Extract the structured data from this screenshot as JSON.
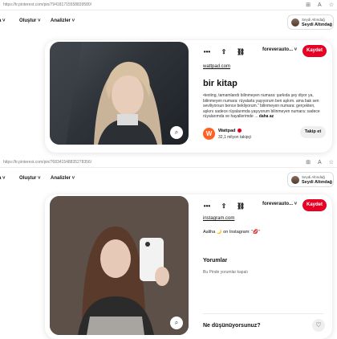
{
  "top_capture": {
    "browser": {
      "url": "https://tr.pinterest.com/pin/794181715558839580/"
    },
    "nav": {
      "left_partial": "a ˅",
      "create": "Oluştur ˅",
      "analytics": "Analizler ˅"
    },
    "account": {
      "subtitle": "Seydi Altındağ",
      "name": "Seydi Altındağ"
    },
    "pin": {
      "actions": [
        "•••",
        "⇧",
        "⛓"
      ],
      "board": "foreverauto... ˅",
      "save_label": "Kaydet",
      "source_link": "wattpad.com",
      "title": "bir kitap",
      "description": "•texting, tamamlandı bilinmeyen numara: şarkıda şey diyor ya, bilinmeyen numara: rüyalarla yaşıyorum ben aşkım. ama bak sen seviliyorsun bence bekliyorum.” bilinmeyen numara: gerçekten, aşkını sadece rüyalarımda yaşıyorum bilinmeyen numara: sadece rüyalarımda ve hayallerimde ...",
      "more": "daha az",
      "creator": {
        "logo_letter": "W",
        "name": "Wattpad",
        "followers": "32,1 milyon takipçi",
        "follow_label": "Takip et"
      }
    }
  },
  "bottom_capture": {
    "browser": {
      "url": "https://tr.pinterest.com/pin/768341548835278356/"
    },
    "nav": {
      "left_partial": "a ˅",
      "create": "Oluştur ˅",
      "analytics": "Analizler ˅"
    },
    "account": {
      "subtitle": "Seydi Altındağ",
      "name": "Seydi Altındağ"
    },
    "pin": {
      "actions": [
        "•••",
        "⇧",
        "⛓"
      ],
      "board": "foreverauto... ˅",
      "save_label": "Kaydet",
      "source_link": "instagram.com",
      "caption": "Aaliha 🌙 on Instagram: \"💋\"",
      "comments_title": "Yorumlar",
      "comments_empty": "Bu Pinde yorumlar kapalı",
      "prompt": "Ne düşünüyorsunuz?",
      "heart": "♡"
    }
  },
  "colors": {
    "save": "#e60023",
    "wattpad": "#ff6122"
  }
}
